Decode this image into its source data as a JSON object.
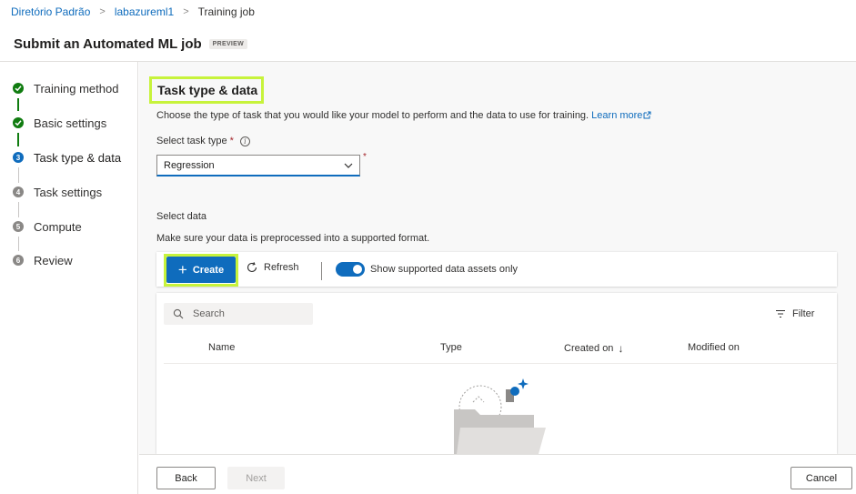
{
  "breadcrumb": {
    "items": [
      "Diretório Padrão",
      "labazureml1"
    ],
    "current": "Training job",
    "separator": ">"
  },
  "header": {
    "title": "Submit an Automated ML job",
    "badge": "PREVIEW"
  },
  "steps": [
    {
      "label": "Training method",
      "status": "done"
    },
    {
      "label": "Basic settings",
      "status": "done"
    },
    {
      "label": "Task type & data",
      "status": "current",
      "number": "3"
    },
    {
      "label": "Task settings",
      "status": "pending",
      "number": "4"
    },
    {
      "label": "Compute",
      "status": "pending",
      "number": "5"
    },
    {
      "label": "Review",
      "status": "pending",
      "number": "6"
    }
  ],
  "section": {
    "title": "Task type & data",
    "description": "Choose the type of task that you would like your model to perform and the data to use for training.",
    "learn_more": "Learn more"
  },
  "task_type": {
    "label": "Select task type",
    "required_marker": "*",
    "value": "Regression"
  },
  "select_data": {
    "label": "Select data",
    "hint": "Make sure your data is preprocessed into a supported format."
  },
  "toolbar": {
    "create_label": "Create",
    "refresh_label": "Refresh",
    "toggle_label": "Show supported data assets only",
    "toggle_on": true
  },
  "grid": {
    "search_placeholder": "Search",
    "filter_label": "Filter",
    "columns": [
      "Name",
      "Type",
      "Created on",
      "Modified on"
    ]
  },
  "footer": {
    "back_label": "Back",
    "next_label": "Next",
    "cancel_label": "Cancel"
  },
  "colors": {
    "accent": "#0f6cbd",
    "success": "#107c10",
    "highlight": "#c7f33b"
  }
}
